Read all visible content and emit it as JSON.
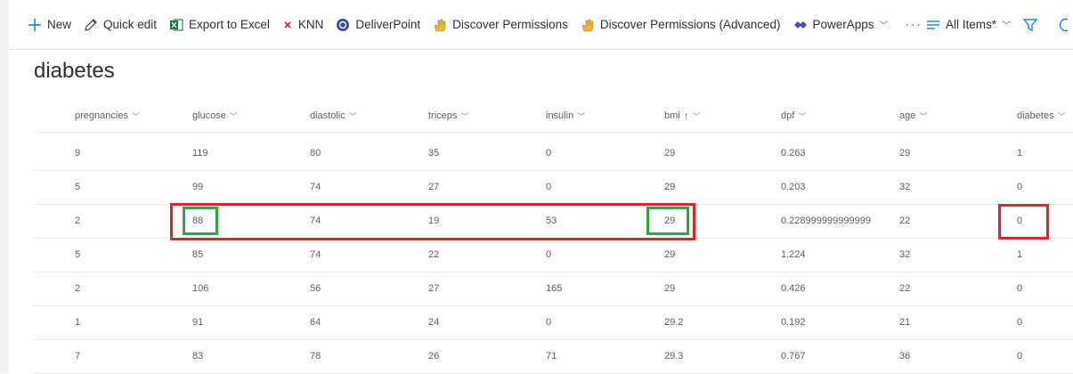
{
  "commandbar": {
    "left": [
      {
        "id": "new",
        "label": "New",
        "icon": "plus-icon"
      },
      {
        "id": "quick-edit",
        "label": "Quick edit",
        "icon": "pencil-icon"
      },
      {
        "id": "export-excel",
        "label": "Export to Excel",
        "icon": "excel-icon"
      },
      {
        "id": "knn",
        "label": "KNN",
        "icon": "knn-icon"
      },
      {
        "id": "deliverpoint",
        "label": "DeliverPoint",
        "icon": "deliverpoint-icon"
      },
      {
        "id": "discover-permissions",
        "label": "Discover Permissions",
        "icon": "hand-icon"
      },
      {
        "id": "discover-permissions-advanced",
        "label": "Discover Permissions (Advanced)",
        "icon": "hand-icon"
      },
      {
        "id": "powerapps",
        "label": "PowerApps",
        "icon": "powerapps-icon"
      }
    ],
    "more_label": "···",
    "view_label": "All Items*"
  },
  "list": {
    "title": "diabetes",
    "columns": [
      "pregnancies",
      "glucose",
      "diastolic",
      "triceps",
      "insulin",
      "bmi",
      "dpf",
      "age",
      "diabetes"
    ],
    "sorted_column": "bmi",
    "sort_indicator": "↑",
    "rows": [
      [
        "9",
        "119",
        "80",
        "35",
        "0",
        "29",
        "0.263",
        "29",
        "1"
      ],
      [
        "5",
        "99",
        "74",
        "27",
        "0",
        "29",
        "0.203",
        "32",
        "0"
      ],
      [
        "2",
        "88",
        "74",
        "19",
        "53",
        "29",
        "0.228999999999999",
        "22",
        "0"
      ],
      [
        "5",
        "85",
        "74",
        "22",
        "0",
        "29",
        "1.224",
        "32",
        "1"
      ],
      [
        "2",
        "106",
        "56",
        "27",
        "165",
        "29",
        "0.426",
        "22",
        "0"
      ],
      [
        "1",
        "91",
        "64",
        "24",
        "0",
        "29.2",
        "0.192",
        "21",
        "0"
      ],
      [
        "7",
        "83",
        "78",
        "26",
        "71",
        "29.3",
        "0.767",
        "36",
        "0"
      ]
    ]
  },
  "colors": {
    "highlight_red": "#e8202a",
    "highlight_green": "#2ba84a",
    "accent": "#0078d4"
  }
}
